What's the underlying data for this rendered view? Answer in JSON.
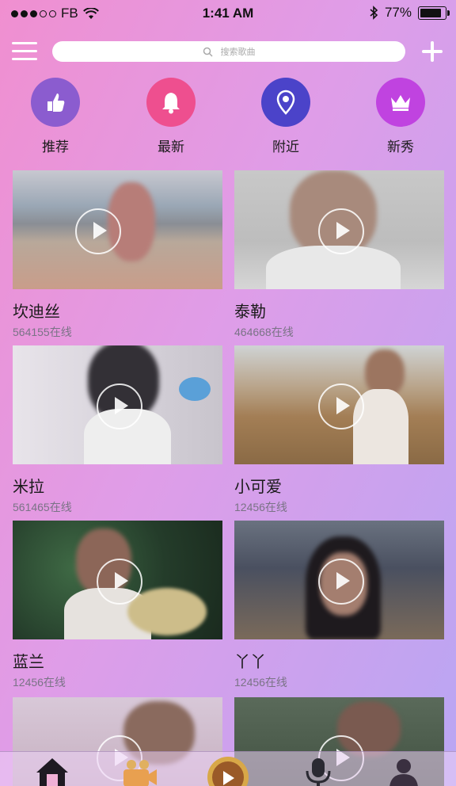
{
  "status_bar": {
    "carrier": "FB",
    "time": "1:41 AM",
    "battery": "77%"
  },
  "search": {
    "placeholder": "搜索歌曲"
  },
  "categories": [
    {
      "label": "推荐",
      "icon": "thumbs-up-icon",
      "color": "#8b5ccf"
    },
    {
      "label": "最新",
      "icon": "bell-icon",
      "color": "#ee4f8f"
    },
    {
      "label": "附近",
      "icon": "location-pin-icon",
      "color": "#4b43c9"
    },
    {
      "label": "新秀",
      "icon": "crown-icon",
      "color": "#c043e0"
    }
  ],
  "streams": [
    {
      "name": "坎迪丝",
      "online": "564155在线"
    },
    {
      "name": "泰勒",
      "online": "464668在线"
    },
    {
      "name": "米拉",
      "online": "561465在线"
    },
    {
      "name": "小可爱",
      "online": "12456在线"
    },
    {
      "name": "蓝兰",
      "online": "12456在线"
    },
    {
      "name": "丫丫",
      "online": "12456在线"
    }
  ],
  "tabbar": [
    {
      "icon": "home-icon"
    },
    {
      "icon": "camera-icon"
    },
    {
      "icon": "live-center-icon"
    },
    {
      "icon": "microphone-icon"
    },
    {
      "icon": "profile-icon"
    }
  ]
}
